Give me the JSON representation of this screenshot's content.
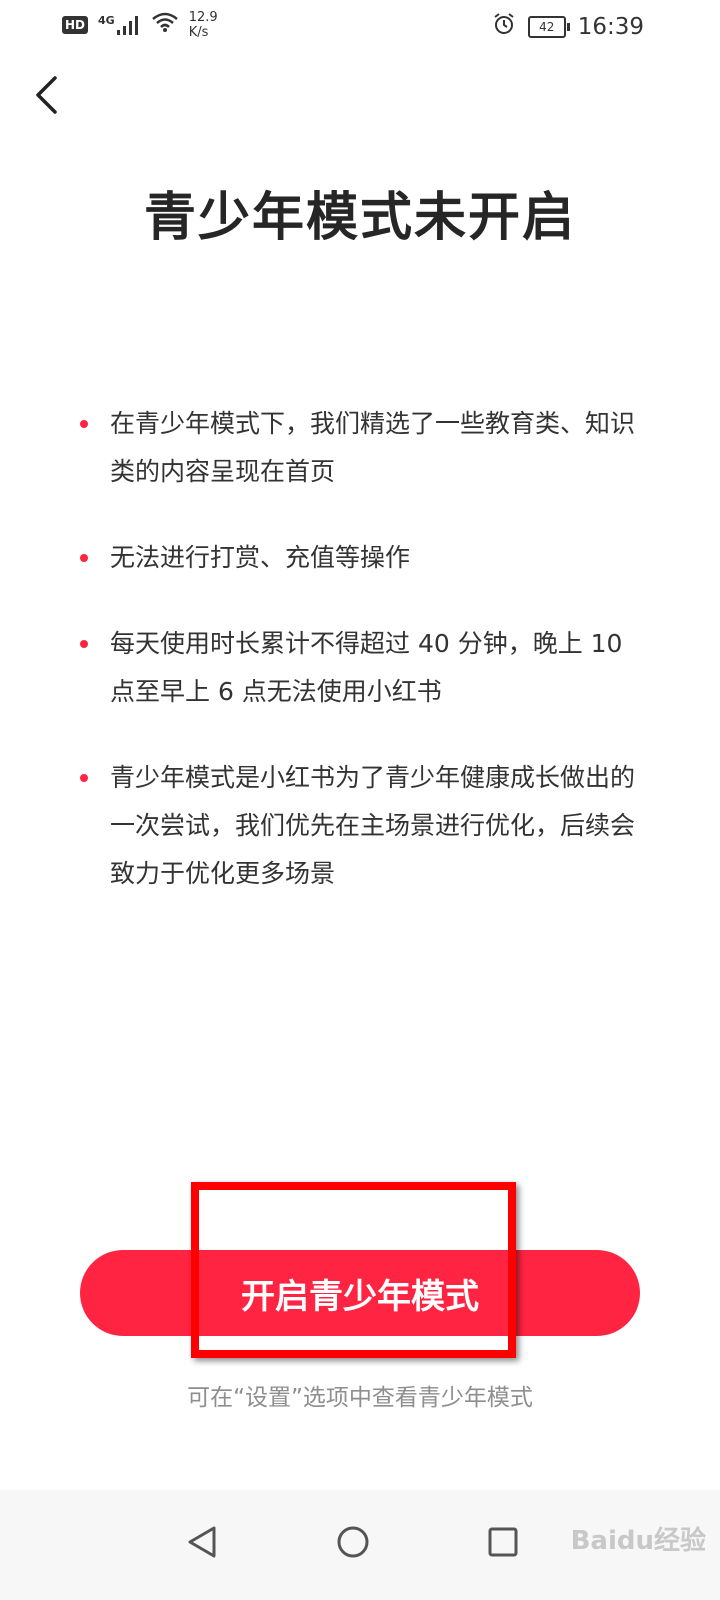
{
  "status_bar": {
    "hd": "HD",
    "network": "4G",
    "speed_value": "12.9",
    "speed_unit": "K/s",
    "battery": "42",
    "time": "16:39"
  },
  "header": {
    "title": "青少年模式未开启"
  },
  "bullets": [
    "在青少年模式下，我们精选了一些教育类、知识类的内容呈现在首页",
    "无法进行打赏、充值等操作",
    "每天使用时长累计不得超过 40 分钟，晚上 10 点至早上 6 点无法使用小红书",
    "青少年模式是小红书为了青少年健康成长做出的一次尝试，我们优先在主场景进行优化，后续会致力于优化更多场景"
  ],
  "cta": {
    "label": "开启青少年模式"
  },
  "hint": "可在“设置”选项中查看青少年模式",
  "watermark": "Baidu经验",
  "colors": {
    "accent": "#ff2442",
    "annotation": "#ff0000"
  },
  "icons": {
    "back": "back-chevron-icon",
    "alarm": "alarm-icon",
    "wifi": "wifi-icon",
    "signal": "signal-icon",
    "nav_back": "nav-back-triangle-icon",
    "nav_home": "nav-home-circle-icon",
    "nav_recent": "nav-recent-square-icon"
  }
}
